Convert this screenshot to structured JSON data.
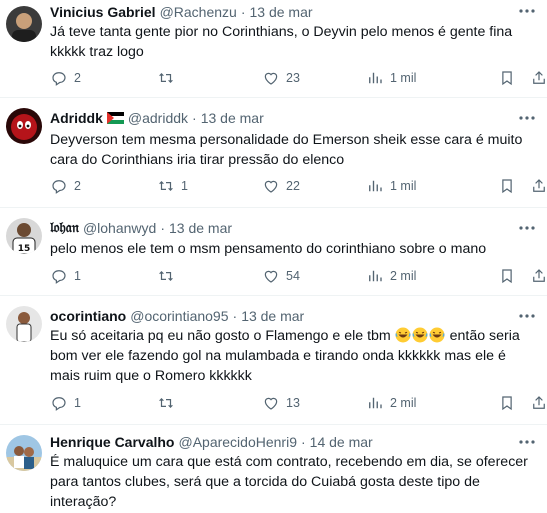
{
  "tweets": [
    {
      "name": "Vinicius Gabriel",
      "handle": "@Rachenzu",
      "date": "13 de mar",
      "text": "Já teve tanta gente pior no Corinthians, o Deyvin pelo menos é gente fina kkkkk traz logo",
      "replies": "2",
      "retweets": "",
      "likes": "23",
      "views": "1 mil"
    },
    {
      "name": "Adriddk",
      "handle": "@adriddk",
      "date": "13 de mar",
      "text": "Deyverson tem mesma personalidade do Emerson sheik esse cara é muito cara do Corinthians iria tirar pressão do elenco",
      "replies": "2",
      "retweets": "1",
      "likes": "22",
      "views": "1 mil"
    },
    {
      "name": "𝔩𝔬𝔥𝔞𝔫",
      "handle": "@lohanwyd",
      "date": "13 de mar",
      "text": "pelo menos ele tem o msm pensamento do corinthiano sobre o mano",
      "replies": "1",
      "retweets": "",
      "likes": "54",
      "views": "2 mil"
    },
    {
      "name": "ocorintiano",
      "handle": "@ocorintiano95",
      "date": "13 de mar",
      "text_a": "Eu só aceitaria pq eu não gosto o Flamengo e ele tbm ",
      "text_b": " então seria bom ver ele fazendo gol na mulambada e tirando onda kkkkkk mas ele é mais ruim que o Romero kkkkkk",
      "replies": "1",
      "retweets": "",
      "likes": "13",
      "views": "2 mil"
    },
    {
      "name": "Henrique Carvalho",
      "handle": "@AparecidoHenri9",
      "date": "14 de mar",
      "text": "É maluquice um cara que está com contrato, recebendo em dia, se oferecer para tantos clubes, será que a torcida do Cuiabá gosta deste tipo de interação?"
    }
  ],
  "dot": "·",
  "colors": {
    "text": "#0f1419",
    "muted": "#536471",
    "divider": "#eff3f4"
  },
  "icons": [
    "reply-icon",
    "retweet-icon",
    "like-icon",
    "views-icon",
    "bookmark-icon",
    "share-icon",
    "more-icon",
    "palestine-flag-icon",
    "laughing-emoji-icon"
  ]
}
